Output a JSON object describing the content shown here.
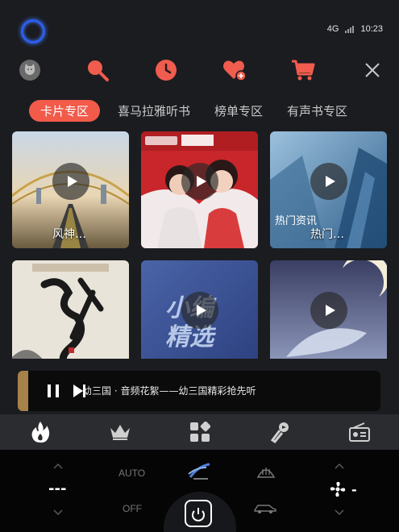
{
  "status": {
    "network": "4G",
    "time": "10:23"
  },
  "top_icons": [
    "avatar-cat",
    "search-icon",
    "history-clock-icon",
    "favorite-heart-icon",
    "cart-icon",
    "close-icon"
  ],
  "tabs": [
    {
      "label": "卡片专区",
      "active": true
    },
    {
      "label": "喜马拉雅听书",
      "active": false
    },
    {
      "label": "榜单专区",
      "active": false
    },
    {
      "label": "有声书专区",
      "active": false
    }
  ],
  "cards": [
    {
      "title": "风神…"
    },
    {
      "title": ""
    },
    {
      "title": "热门…",
      "overlay": "热门资讯"
    },
    {
      "title": ""
    },
    {
      "title": "",
      "overlay": "小编\n精选"
    },
    {
      "title": ""
    }
  ],
  "player": {
    "now_playing": "幼三国 · 音频花絮——幼三国精彩抢先听"
  },
  "bottom_nav": [
    "hot-fire-icon",
    "crown-icon",
    "apps-grid-icon",
    "karaoke-mic-icon",
    "radio-icon"
  ],
  "climate": {
    "left_temp": "---",
    "auto_label": "AUTO",
    "off_label": "OFF",
    "fan_value": "-"
  },
  "colors": {
    "accent": "#f25a4a",
    "background": "#1b1c20"
  }
}
